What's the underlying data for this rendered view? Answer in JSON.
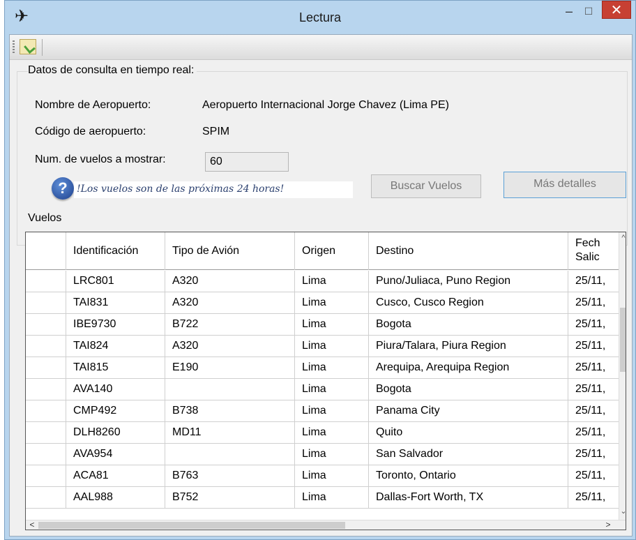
{
  "window": {
    "title": "Lectura",
    "app_icon": "airplane-icon",
    "minimize_glyph": "–",
    "maximize_glyph": "☐",
    "close_glyph": "✕"
  },
  "toolbar": {
    "button_icon": "edit-save-icon"
  },
  "consulta": {
    "group_title": "Datos de consulta en tiempo real:",
    "airport_name_label": "Nombre de Aeropuerto:",
    "airport_name_value": "Aeropuerto Internacional Jorge Chavez (Lima PE)",
    "airport_code_label": "Código de aeropuerto:",
    "airport_code_value": "SPIM",
    "num_flights_label": "Num. de vuelos a mostrar:",
    "num_flights_value": "60",
    "help_glyph": "?",
    "help_text": "!Los vuelos son de las próximas 24 horas!",
    "search_button": "Buscar Vuelos",
    "details_button": "Más detalles"
  },
  "vuelos": {
    "group_title": "Vuelos",
    "columns": [
      "",
      "Identificación",
      "Tipo de Avión",
      "Origen",
      "Destino",
      "Fech Salic"
    ],
    "column_header_lines": {
      "fecha_line1": "Fech",
      "fecha_line2": "Salic"
    },
    "rows": [
      {
        "id": "LRC801",
        "tipo": "A320",
        "origen": "Lima",
        "destino": "Puno/Juliaca, Puno Region",
        "fecha": "25/11,"
      },
      {
        "id": "TAI831",
        "tipo": "A320",
        "origen": "Lima",
        "destino": "Cusco, Cusco Region",
        "fecha": "25/11,"
      },
      {
        "id": "IBE9730",
        "tipo": "B722",
        "origen": "Lima",
        "destino": "Bogota",
        "fecha": "25/11,"
      },
      {
        "id": "TAI824",
        "tipo": "A320",
        "origen": "Lima",
        "destino": "Piura/Talara, Piura Region",
        "fecha": "25/11,"
      },
      {
        "id": "TAI815",
        "tipo": "E190",
        "origen": "Lima",
        "destino": "Arequipa, Arequipa Region",
        "fecha": "25/11,"
      },
      {
        "id": "AVA140",
        "tipo": "",
        "origen": "Lima",
        "destino": "Bogota",
        "fecha": "25/11,"
      },
      {
        "id": "CMP492",
        "tipo": "B738",
        "origen": "Lima",
        "destino": "Panama City",
        "fecha": "25/11,"
      },
      {
        "id": "DLH8260",
        "tipo": "MD11",
        "origen": "Lima",
        "destino": "Quito",
        "fecha": "25/11,"
      },
      {
        "id": "AVA954",
        "tipo": "",
        "origen": "Lima",
        "destino": "San Salvador",
        "fecha": "25/11,"
      },
      {
        "id": "ACA81",
        "tipo": "B763",
        "origen": "Lima",
        "destino": "Toronto, Ontario",
        "fecha": "25/11,"
      },
      {
        "id": "AAL988",
        "tipo": "B752",
        "origen": "Lima",
        "destino": "Dallas-Fort Worth, TX",
        "fecha": "25/11,"
      }
    ],
    "scroll_up": "^",
    "scroll_down": "⌄",
    "scroll_left": "<",
    "scroll_right": ">"
  }
}
